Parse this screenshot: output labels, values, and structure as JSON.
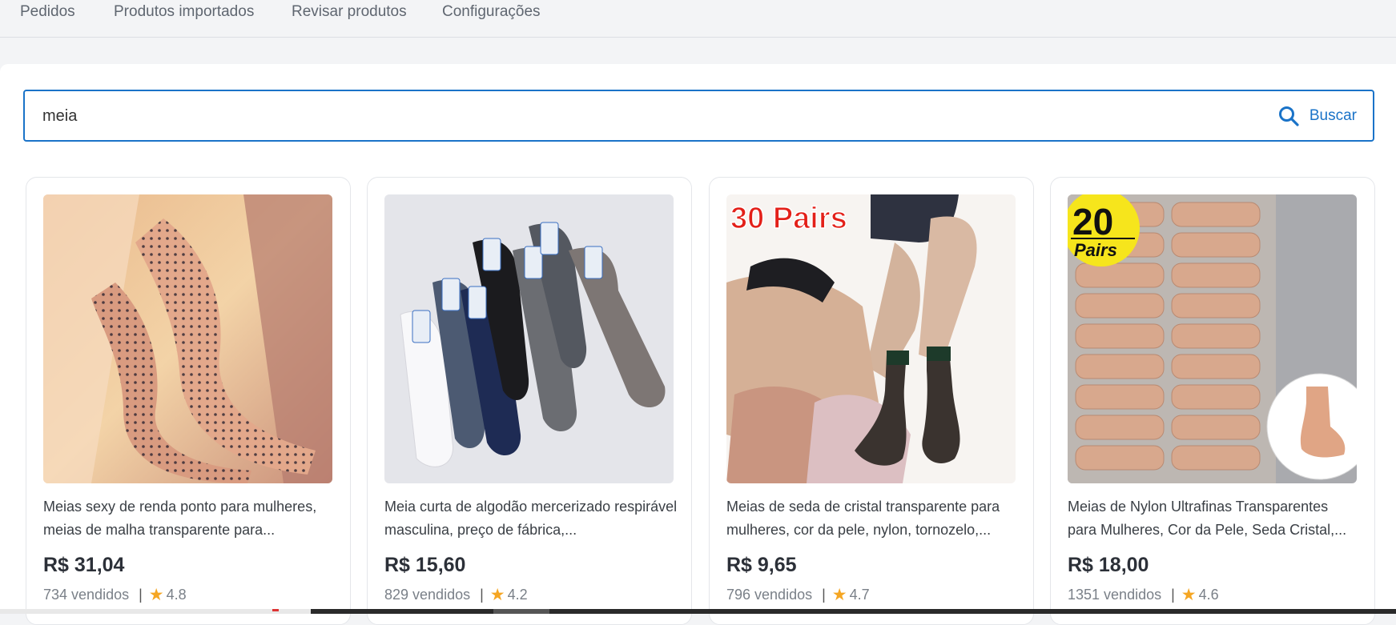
{
  "nav": {
    "items": [
      {
        "label": "Pedidos"
      },
      {
        "label": "Produtos importados"
      },
      {
        "label": "Revisar produtos"
      },
      {
        "label": "Configurações"
      }
    ]
  },
  "search": {
    "value": "meia",
    "button_label": "Buscar",
    "icon": "search-icon",
    "accent_color": "#1a73c8"
  },
  "products": [
    {
      "title": "Meias sexy de renda ponto para mulheres, meias de malha transparente para...",
      "price": "R$ 31,04",
      "sold": "734 vendidos",
      "separator": "|",
      "rating": "4.8",
      "image": "sheer-polka-dot-socks"
    },
    {
      "title": "Meia curta de algodão mercerizado respirável masculina, preço de fábrica,...",
      "price": "R$ 15,60",
      "sold": "829 vendidos",
      "separator": "|",
      "rating": "4.2",
      "image": "packaged-mens-socks"
    },
    {
      "title": "Meias de seda de cristal transparente para mulheres, cor da pele, nylon, tornozelo,...",
      "price": "R$ 9,65",
      "sold": "796 vendidos",
      "separator": "|",
      "rating": "4.7",
      "image": "nylon-ankle-socks",
      "image_text": "30 Pairs"
    },
    {
      "title": "Meias de Nylon Ultrafinas Transparentes para Mulheres, Cor da Pele, Seda Cristal,...",
      "price": "R$ 18,00",
      "sold": "1351 vendidos",
      "separator": "|",
      "rating": "4.6",
      "image": "boxed-nylon-socks",
      "image_text_number": "20",
      "image_text_word": "Pairs"
    }
  ],
  "star_color": "#f5a623"
}
